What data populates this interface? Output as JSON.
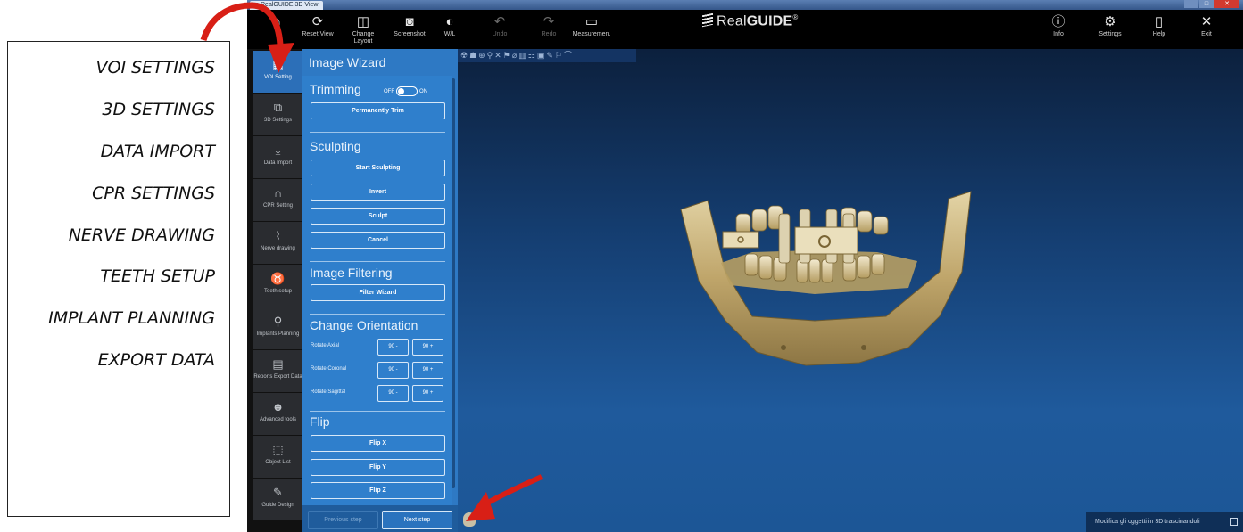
{
  "annotations": [
    "VOI SETTINGS",
    "3D SETTINGS",
    "DATA IMPORT",
    "CPR SETTINGS",
    "NERVE DRAWING",
    "TEETH SETUP",
    "IMPLANT PLANNING",
    "EXPORT DATA"
  ],
  "window": {
    "tab_title": "RealGUIDE 3D View"
  },
  "toolbar": {
    "reset_view": "Reset View",
    "change_layout": "Change Layout",
    "screenshot": "Screenshot",
    "wl": "W/L",
    "undo": "Undo",
    "redo": "Redo",
    "measurement": "Measuremen.",
    "brand_light": "Real",
    "brand_bold": "GUIDE",
    "brand_mark": "®",
    "info": "Info",
    "settings": "Settings",
    "help": "Help",
    "exit": "Exit"
  },
  "leftnav": {
    "voi": "VOI Setting",
    "settings3d": "3D Settings",
    "data_import": "Data Import",
    "cpr": "CPR Setting",
    "nerve": "Nerve drawing",
    "teeth": "Teeth setup",
    "implants": "Implants Planning",
    "reports": "Reports Export Data",
    "advanced": "Advanced tools",
    "objects": "Object List",
    "guide": "Guide Design"
  },
  "wizard": {
    "title": "Image Wizard",
    "trimming": {
      "title": "Trimming",
      "toggle_off": "OFF",
      "toggle_on": "ON",
      "toggle_state": "off",
      "permanently_trim": "Permanently Trim"
    },
    "sculpting": {
      "title": "Sculpting",
      "start": "Start Sculpting",
      "invert": "Invert",
      "sculpt": "Sculpt",
      "cancel": "Cancel"
    },
    "filtering": {
      "title": "Image Filtering",
      "filter_wizard": "Filter Wizard"
    },
    "orientation": {
      "title": "Change Orientation",
      "axial": "Rotate Axial",
      "coronal": "Rotate Coronal",
      "sagittal": "Rotate Sagittal",
      "minus": "90 -",
      "plus": "90 +"
    },
    "flip": {
      "title": "Flip",
      "x": "Flip X",
      "y": "Flip Y",
      "z": "Flip Z"
    },
    "previous_step": "Previous step",
    "next_step": "Next step"
  },
  "status": {
    "hint": "Modifica gli oggetti in 3D trascinandoli"
  },
  "colors": {
    "panel_blue": "#2e79c4",
    "viewport_top": "#0c203d",
    "viewport_bottom": "#1f5a9c",
    "bone": "#c8b27a",
    "arrow_red": "#d81f16"
  }
}
